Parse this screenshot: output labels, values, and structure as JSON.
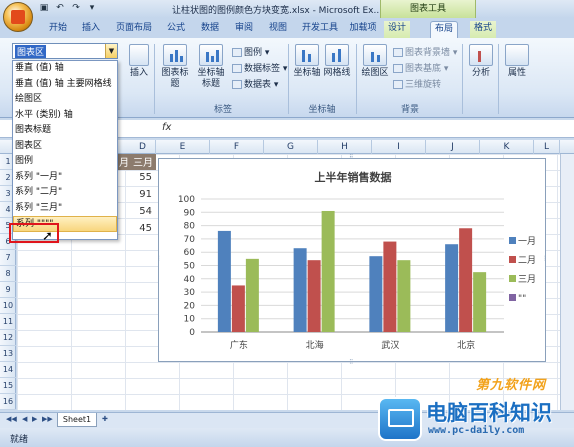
{
  "app": {
    "doc_title": "让柱状图的图例颜色方块变宽.xlsx - Microsoft Ex...",
    "context_tools": "图表工具"
  },
  "tabs": [
    "开始",
    "插入",
    "页面布局",
    "公式",
    "数据",
    "审阅",
    "视图",
    "开发工具",
    "加载项",
    "设计",
    "布局",
    "格式"
  ],
  "ribbon": {
    "insert_label": "插入",
    "chart_title_label": "图表标题",
    "axis_title_label": "坐标轴标题",
    "legend": "图例",
    "data_labels": "数据标签",
    "data_table": "数据表",
    "labels_group": "标签",
    "axes_label": "坐标轴",
    "gridlines_label": "网格线",
    "axes_group": "坐标轴",
    "plot_area_label": "绘图区",
    "chart_wall": "图表背景墙",
    "chart_floor": "图表基底",
    "rotation": "三维旋转",
    "background_group": "背景",
    "analysis_label": "分析",
    "properties_label": "属性"
  },
  "selector": {
    "value": "图表区",
    "items": [
      "垂直 (值) 轴",
      "垂直 (值) 轴 主要网格线",
      "绘图区",
      "水平 (类别) 轴",
      "图表标题",
      "图表区",
      "图例",
      "系列 \"一月\"",
      "系列 \"二月\"",
      "系列 \"三月\"",
      "系列 \"\"\"\""
    ]
  },
  "formula": {
    "fx": "fx"
  },
  "columns": [
    "D",
    "E",
    "F",
    "G",
    "H",
    "I",
    "J",
    "K",
    "L"
  ],
  "rows": [
    "1",
    "2",
    "3",
    "4",
    "5",
    "6",
    "7",
    "8",
    "9",
    "10",
    "11",
    "12",
    "13",
    "14",
    "15",
    "16"
  ],
  "sheet": {
    "header_c": "月",
    "header_d": "三月",
    "d_values": [
      "55",
      "91",
      "54",
      "45"
    ]
  },
  "chart_data": {
    "type": "bar",
    "title": "上半年销售数据",
    "categories": [
      "广东",
      "北海",
      "武汉",
      "北京"
    ],
    "series": [
      {
        "name": "一月",
        "color": "#4f81bd",
        "values": [
          76,
          63,
          57,
          66
        ]
      },
      {
        "name": "二月",
        "color": "#c0504d",
        "values": [
          35,
          54,
          68,
          78
        ]
      },
      {
        "name": "三月",
        "color": "#9bbb59",
        "values": [
          55,
          91,
          54,
          45
        ]
      }
    ],
    "legend_extra": "\"\"",
    "legend_extra_color": "#8064a2",
    "ylim": [
      0,
      100
    ],
    "yticks": [
      "0",
      "10",
      "20",
      "30",
      "40",
      "50",
      "60",
      "70",
      "80",
      "90",
      "100"
    ],
    "grid": true,
    "legend_position": "right"
  },
  "sheet_tab": "Sheet1",
  "status": "就绪",
  "watermark": {
    "top": "第九软件网",
    "main": "电脑百科知识",
    "url": "www.pc-daily.com"
  }
}
